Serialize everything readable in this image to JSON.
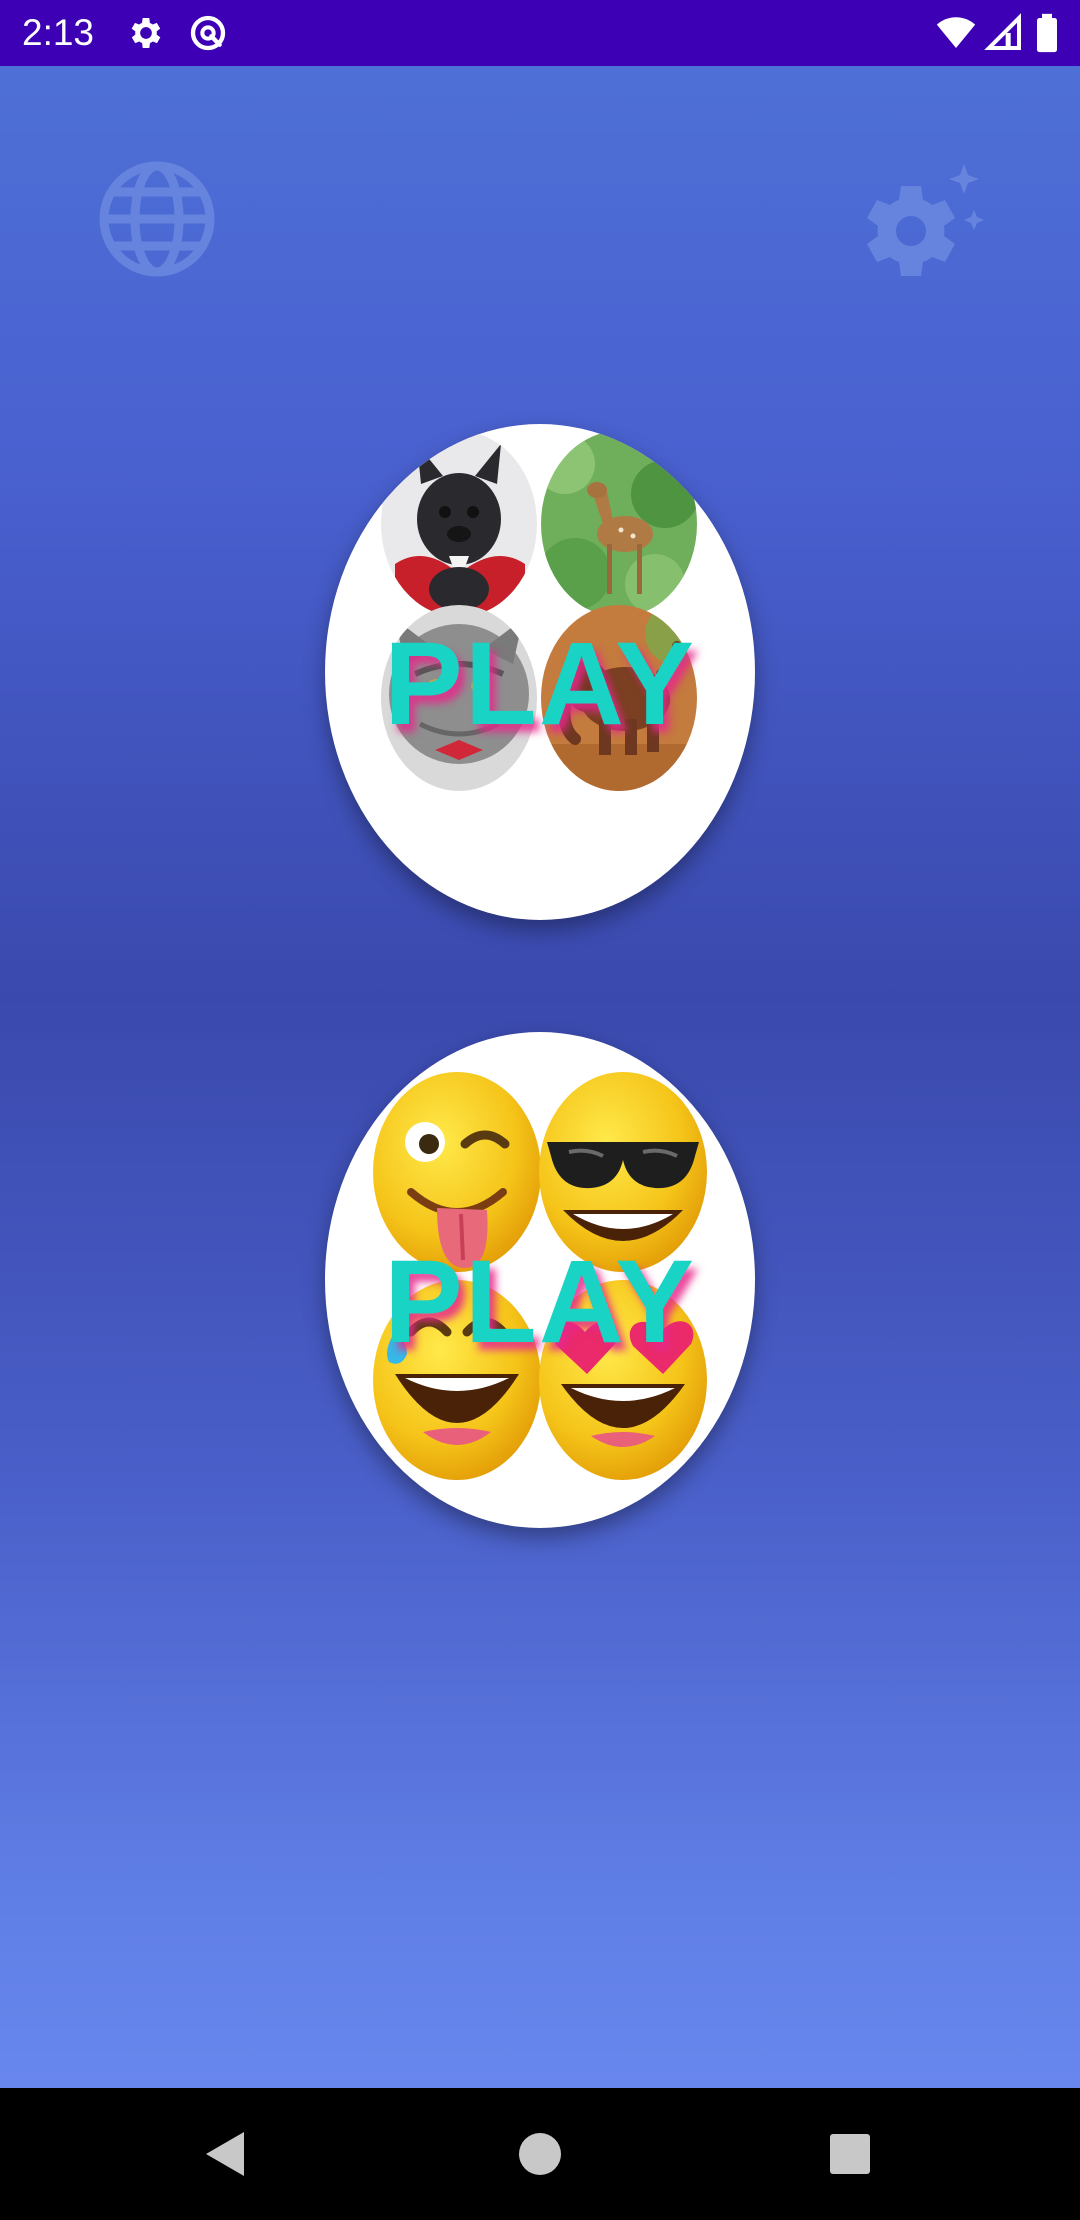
{
  "status_bar": {
    "time": "2:13",
    "left_icons": [
      "settings-gear-icon",
      "at-sign-icon"
    ],
    "right_icons": [
      "wifi-icon",
      "signal-icon",
      "battery-icon"
    ],
    "background_color": "#3d00b5"
  },
  "top_actions": {
    "language_icon": "globe-icon",
    "settings_icon": "settings-sparkle-icon"
  },
  "cards": [
    {
      "theme": "animals",
      "label": "PLAY",
      "images": [
        "french-bulldog",
        "deer-fawn",
        "cat",
        "elephant"
      ]
    },
    {
      "theme": "emoji",
      "label": "PLAY",
      "images": [
        "winking-tongue-emoji",
        "sunglasses-emoji",
        "sweat-smile-emoji",
        "heart-eyes-emoji"
      ]
    }
  ],
  "nav_bar": {
    "buttons": [
      "back-icon",
      "home-icon",
      "recents-icon"
    ]
  },
  "colors": {
    "play_text": "#19d3c5",
    "play_shadow": "#e6288c",
    "gradient_top": "#4e70d6",
    "gradient_mid": "#3a49ad",
    "gradient_bottom": "#6887ee"
  }
}
